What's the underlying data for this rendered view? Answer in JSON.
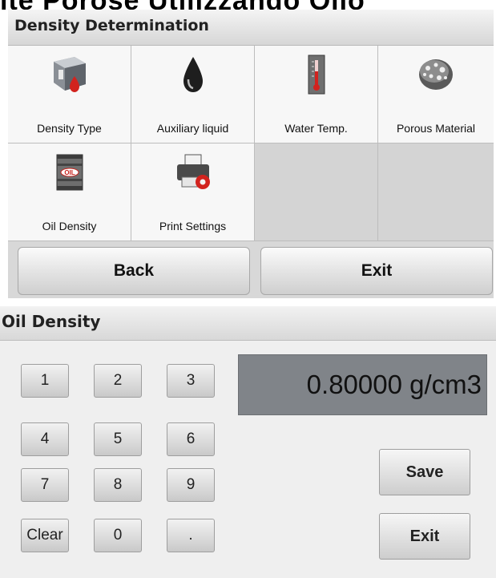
{
  "page_top_title": "ité Porose Utilizzando Olio",
  "density_panel": {
    "title": "Density Determination",
    "tiles": [
      {
        "label": "Density Type",
        "icon": "density-type-icon"
      },
      {
        "label": "Auxiliary liquid",
        "icon": "liquid-drop-icon"
      },
      {
        "label": "Water Temp.",
        "icon": "thermometer-icon"
      },
      {
        "label": "Porous Material",
        "icon": "porous-material-icon"
      },
      {
        "label": "Oil Density",
        "icon": "oil-barrel-icon"
      },
      {
        "label": "Print Settings",
        "icon": "printer-settings-icon"
      }
    ],
    "back_label": "Back",
    "exit_label": "Exit"
  },
  "oil_panel": {
    "title": "Oil Density",
    "display_value": "0.80000 g/cm3",
    "keys": [
      "1",
      "2",
      "3",
      "4",
      "5",
      "6",
      "7",
      "8",
      "9",
      "Clear",
      "0",
      "."
    ],
    "save_label": "Save",
    "exit_label": "Exit"
  },
  "colors": {
    "display_bg": "#808489",
    "drop_red": "#d2231e",
    "oil_red": "#c8221c"
  }
}
